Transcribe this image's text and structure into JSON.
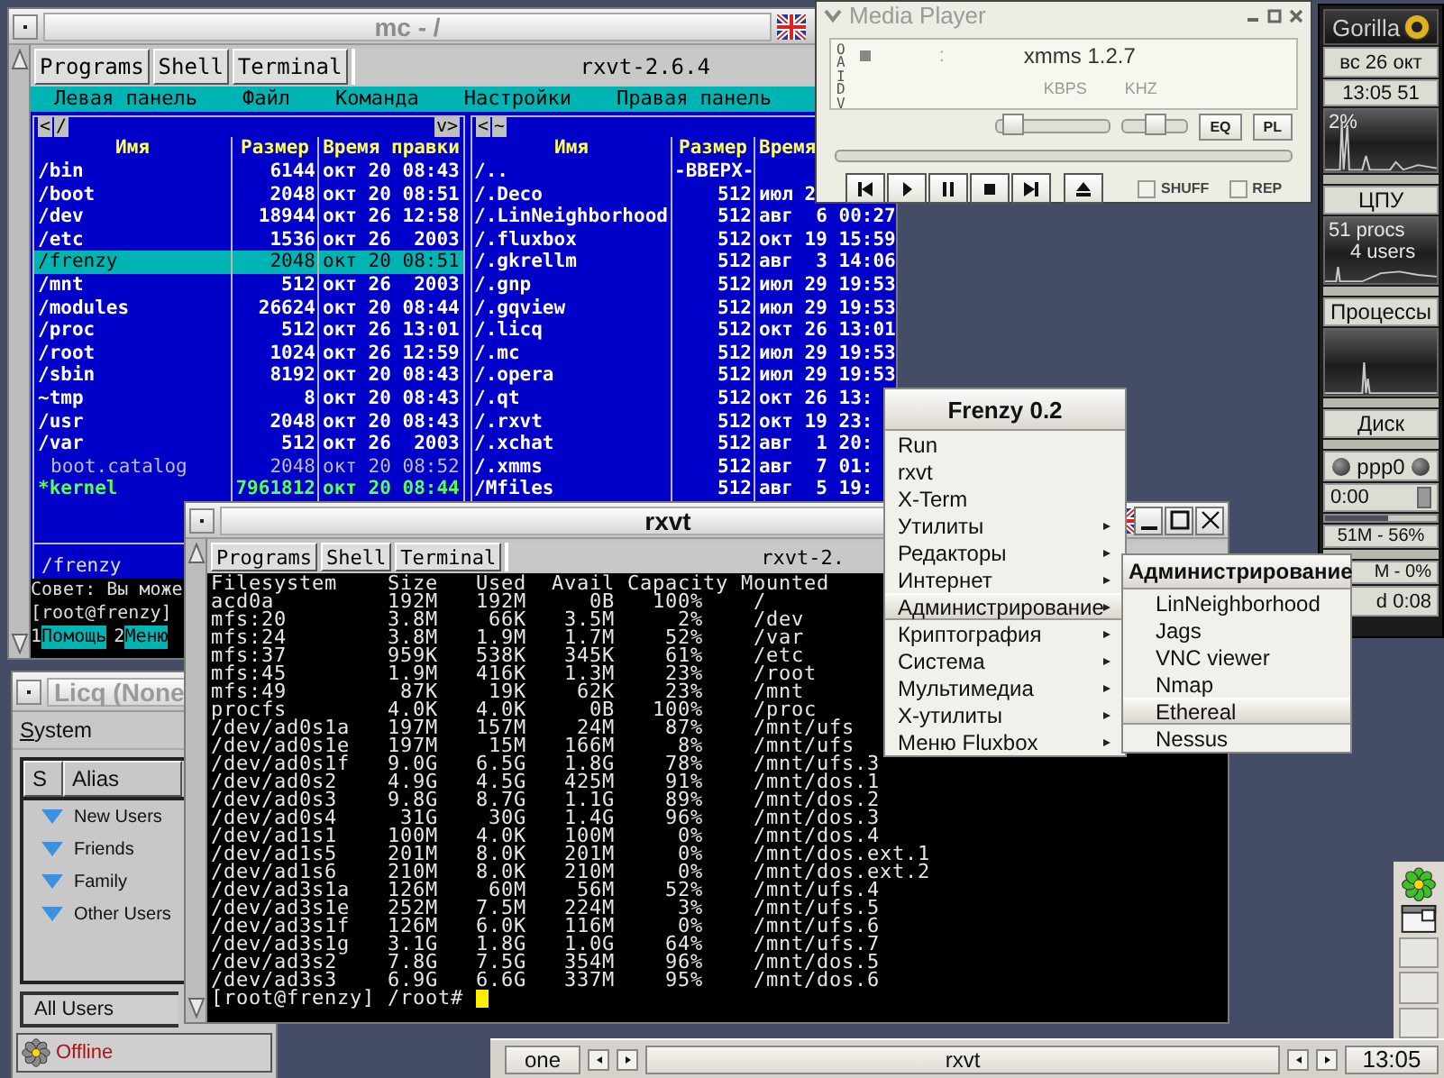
{
  "mc_window": {
    "title": "mc - /",
    "tabs": [
      "Programs",
      "Shell",
      "Terminal"
    ],
    "terminal_title": "rxvt-2.6.4",
    "menu": [
      "Левая панель",
      "Файл",
      "Команда",
      "Настройки",
      "Правая панель"
    ],
    "left_panel": {
      "back": "<",
      "path": "/",
      "more": "v>",
      "columns": [
        "Имя",
        "Размер",
        "Время правки"
      ],
      "rows": [
        {
          "name": "/bin",
          "size": "6144",
          "time": "окт 20 08:43",
          "kind": "dir",
          "selected": false
        },
        {
          "name": "/boot",
          "size": "2048",
          "time": "окт 20 08:51",
          "kind": "dir",
          "selected": false
        },
        {
          "name": "/dev",
          "size": "18944",
          "time": "окт 26 12:58",
          "kind": "dir",
          "selected": false
        },
        {
          "name": "/etc",
          "size": "1536",
          "time": "окт 26  2003",
          "kind": "dir",
          "selected": false
        },
        {
          "name": "/frenzy",
          "size": "2048",
          "time": "окт 20 08:51",
          "kind": "dir",
          "selected": true
        },
        {
          "name": "/mnt",
          "size": "512",
          "time": "окт 26  2003",
          "kind": "dir",
          "selected": false
        },
        {
          "name": "/modules",
          "size": "26624",
          "time": "окт 20 08:44",
          "kind": "dir",
          "selected": false
        },
        {
          "name": "/proc",
          "size": "512",
          "time": "окт 26 13:01",
          "kind": "dir",
          "selected": false
        },
        {
          "name": "/root",
          "size": "1024",
          "time": "окт 26 12:59",
          "kind": "dir",
          "selected": false
        },
        {
          "name": "/sbin",
          "size": "8192",
          "time": "окт 20 08:43",
          "kind": "dir",
          "selected": false
        },
        {
          "name": "~tmp",
          "size": "8",
          "time": "окт 20 08:43",
          "kind": "dir",
          "selected": false
        },
        {
          "name": "/usr",
          "size": "2048",
          "time": "окт 20 08:43",
          "kind": "dir",
          "selected": false
        },
        {
          "name": "/var",
          "size": "512",
          "time": "окт 26  2003",
          "kind": "dir",
          "selected": false
        },
        {
          "name": "boot.catalog",
          "size": "2048",
          "time": "окт 20 08:52",
          "kind": "file",
          "selected": false
        },
        {
          "name": "*kernel",
          "size": "7961812",
          "time": "окт 20 08:44",
          "kind": "exec",
          "selected": false
        }
      ],
      "footer": "/frenzy"
    },
    "right_panel": {
      "back": "<",
      "path": "~",
      "columns": [
        "Имя",
        "Размер",
        "Время"
      ],
      "rows": [
        {
          "name": "/..",
          "size": "-ВВЕРХ-"
        },
        {
          "name": "/.Deco",
          "size": "512",
          "time": "июл 2"
        },
        {
          "name": "/.LinNeighborhood",
          "size": "512",
          "time": "авг  6 00:27"
        },
        {
          "name": "/.fluxbox",
          "size": "512",
          "time": "окт 19 15:59"
        },
        {
          "name": "/.gkrellm",
          "size": "512",
          "time": "авг  3 14:06"
        },
        {
          "name": "/.gnp",
          "size": "512",
          "time": "июл 29 19:53"
        },
        {
          "name": "/.gqview",
          "size": "512",
          "time": "июл 29 19:53"
        },
        {
          "name": "/.licq",
          "size": "512",
          "time": "окт 26 13:01"
        },
        {
          "name": "/.mc",
          "size": "512",
          "time": "июл 29 19:53"
        },
        {
          "name": "/.opera",
          "size": "512",
          "time": "июл 29 19:53"
        },
        {
          "name": "/.qt",
          "size": "512",
          "time": "окт 26 13:"
        },
        {
          "name": "/.rxvt",
          "size": "512",
          "time": "окт 19 23:"
        },
        {
          "name": "/.xchat",
          "size": "512",
          "time": "авг  1 20:"
        },
        {
          "name": "/.xmms",
          "size": "512",
          "time": "авг  7 01:"
        },
        {
          "name": "/Mfiles",
          "size": "512",
          "time": "авг  5 19:"
        }
      ]
    },
    "hint": "Совет: Вы може",
    "prompt": "[root@frenzy]",
    "keys": [
      {
        "number": "1",
        "label": "Помощь"
      },
      {
        "number": "2",
        "label": "Меню"
      }
    ]
  },
  "licq": {
    "title": "Licq (None",
    "menu": "System",
    "columns": [
      "S",
      "Alias"
    ],
    "groups": [
      "New Users",
      "Friends",
      "Family",
      "Other Users"
    ],
    "filter": "All Users",
    "status": "Offline"
  },
  "xmms": {
    "title": "Media Player",
    "clutterbar": "OAIDV",
    "time_separator": ":",
    "song": "xmms 1.2.7",
    "bitrate_label": "KBPS",
    "samplerate_label": "KHZ",
    "volume": {
      "level": 0.05
    },
    "balance": {
      "level": 0.5
    },
    "buttons": [
      "EQ",
      "PL"
    ],
    "shuffle": {
      "label": "SHUFF",
      "checked": false
    },
    "repeat": {
      "label": "REP",
      "checked": false
    }
  },
  "gkrellm": {
    "hostname": "Gorilla",
    "date": "вс 26 окт",
    "time": "13:05 51",
    "cpu": {
      "reading": "2%",
      "label": "ЦПУ"
    },
    "procs": {
      "processes": "51 procs",
      "users": "4 users",
      "label": "Процессы"
    },
    "disk": {
      "label": "Диск"
    },
    "net": {
      "interface": "ppp0",
      "timer": "0:00"
    },
    "memory": {
      "level": 0.56,
      "reading": "51M - 56%"
    },
    "swap": {
      "reading": "M - 0%"
    },
    "uptime": "d 0:08"
  },
  "rxvt": {
    "title": "rxvt",
    "tabs": [
      "Programs",
      "Shell",
      "Terminal"
    ],
    "terminal_title": "rxvt-2.",
    "df": {
      "columns": [
        "Filesystem",
        "Size",
        "Used",
        "Avail",
        "Capacity",
        "Mounted"
      ],
      "rows": [
        [
          "acd0a",
          "192M",
          "192M",
          "0B",
          "100%",
          "/"
        ],
        [
          "mfs:20",
          "3.8M",
          "66K",
          "3.5M",
          "2%",
          "/dev"
        ],
        [
          "mfs:24",
          "3.8M",
          "1.9M",
          "1.7M",
          "52%",
          "/var"
        ],
        [
          "mfs:37",
          "959K",
          "538K",
          "345K",
          "61%",
          "/etc"
        ],
        [
          "mfs:45",
          "1.9M",
          "416K",
          "1.3M",
          "23%",
          "/root"
        ],
        [
          "mfs:49",
          "87K",
          "19K",
          "62K",
          "23%",
          "/mnt"
        ],
        [
          "procfs",
          "4.0K",
          "4.0K",
          "0B",
          "100%",
          "/proc"
        ],
        [
          "/dev/ad0s1a",
          "197M",
          "157M",
          "24M",
          "87%",
          "/mnt/ufs"
        ],
        [
          "/dev/ad0s1e",
          "197M",
          "15M",
          "166M",
          "8%",
          "/mnt/ufs"
        ],
        [
          "/dev/ad0s1f",
          "9.0G",
          "6.5G",
          "1.8G",
          "78%",
          "/mnt/ufs.3"
        ],
        [
          "/dev/ad0s2",
          "4.9G",
          "4.5G",
          "425M",
          "91%",
          "/mnt/dos.1"
        ],
        [
          "/dev/ad0s3",
          "9.8G",
          "8.7G",
          "1.1G",
          "89%",
          "/mnt/dos.2"
        ],
        [
          "/dev/ad0s4",
          "31G",
          "30G",
          "1.4G",
          "96%",
          "/mnt/dos.3"
        ],
        [
          "/dev/ad1s1",
          "100M",
          "4.0K",
          "100M",
          "0%",
          "/mnt/dos.4"
        ],
        [
          "/dev/ad1s5",
          "201M",
          "8.0K",
          "201M",
          "0%",
          "/mnt/dos.ext.1"
        ],
        [
          "/dev/ad1s6",
          "210M",
          "8.0K",
          "210M",
          "0%",
          "/mnt/dos.ext.2"
        ],
        [
          "/dev/ad3s1a",
          "126M",
          "60M",
          "56M",
          "52%",
          "/mnt/ufs.4"
        ],
        [
          "/dev/ad3s1e",
          "252M",
          "7.5M",
          "224M",
          "3%",
          "/mnt/ufs.5"
        ],
        [
          "/dev/ad3s1f",
          "126M",
          "6.0K",
          "116M",
          "0%",
          "/mnt/ufs.6"
        ],
        [
          "/dev/ad3s1g",
          "3.1G",
          "1.8G",
          "1.0G",
          "64%",
          "/mnt/ufs.7"
        ],
        [
          "/dev/ad3s2",
          "7.8G",
          "7.5G",
          "354M",
          "96%",
          "/mnt/dos.5"
        ],
        [
          "/dev/ad3s3",
          "6.9G",
          "6.6G",
          "337M",
          "95%",
          "/mnt/dos.6"
        ]
      ]
    },
    "prompt": "[root@frenzy] /root#"
  },
  "menu": {
    "title": "Frenzy 0.2",
    "items": [
      {
        "label": "Run",
        "kind": "command",
        "selected": false
      },
      {
        "label": "rxvt",
        "kind": "command",
        "selected": false
      },
      {
        "label": "X-Term",
        "kind": "command",
        "selected": false
      },
      {
        "label": "Утилиты",
        "kind": "submenu",
        "selected": false
      },
      {
        "label": "Редакторы",
        "kind": "submenu",
        "selected": false
      },
      {
        "label": "Интернет",
        "kind": "submenu",
        "selected": false
      },
      {
        "label": "Администрирование",
        "kind": "submenu",
        "selected": true
      },
      {
        "label": "Криптография",
        "kind": "submenu",
        "selected": false
      },
      {
        "label": "Система",
        "kind": "submenu",
        "selected": false
      },
      {
        "label": "Мультимедиа",
        "kind": "submenu",
        "selected": false
      },
      {
        "label": "X-утилиты",
        "kind": "submenu",
        "selected": false
      },
      {
        "label": "Меню Fluxbox",
        "kind": "submenu",
        "selected": false
      }
    ],
    "submenu": {
      "title": "Администрирование",
      "items": [
        {
          "label": "LinNeighborhood",
          "selected": false
        },
        {
          "label": "Jags",
          "selected": false
        },
        {
          "label": "VNC viewer",
          "selected": false
        },
        {
          "label": "Nmap",
          "selected": false
        },
        {
          "label": "Ethereal",
          "selected": true
        },
        {
          "label": "Nessus",
          "selected": false
        }
      ]
    }
  },
  "taskbar": {
    "workspace": "one",
    "task": "rxvt",
    "clock": "13:05"
  }
}
